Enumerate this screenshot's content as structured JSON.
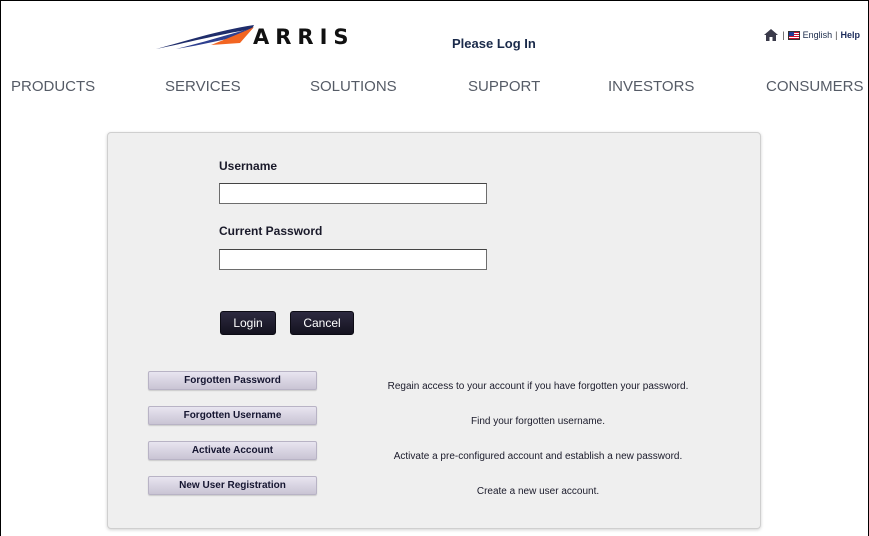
{
  "header": {
    "logo_text": "ARRIS",
    "page_title": "Please Log In",
    "language": "English",
    "separator": "|",
    "help": "Help"
  },
  "nav": {
    "items": [
      "PRODUCTS",
      "SERVICES",
      "SOLUTIONS",
      "SUPPORT",
      "INVESTORS",
      "CONSUMERS"
    ]
  },
  "form": {
    "username_label": "Username",
    "username_value": "",
    "password_label": "Current Password",
    "password_value": "",
    "login_label": "Login",
    "cancel_label": "Cancel"
  },
  "links": [
    {
      "label": "Forgotten Password",
      "description": "Regain access to your account if you have forgotten your password."
    },
    {
      "label": "Forgotten Username",
      "description": "Find your forgotten username."
    },
    {
      "label": "Activate Account",
      "description": "Activate a pre-configured account and establish a new password."
    },
    {
      "label": "New User Registration",
      "description": "Create a new user account."
    }
  ],
  "icons": {
    "home": "home-icon",
    "flag": "us-flag-icon",
    "logo": "arris-swoosh-logo"
  },
  "colors": {
    "panel_bg": "#efefef",
    "dark_button": "#1e1b2e",
    "link_button": "#d6d2e0",
    "title_text": "#1a2a4a",
    "logo_swoosh_dark": "#1f2d6b",
    "logo_swoosh_accent": "#f26522"
  }
}
